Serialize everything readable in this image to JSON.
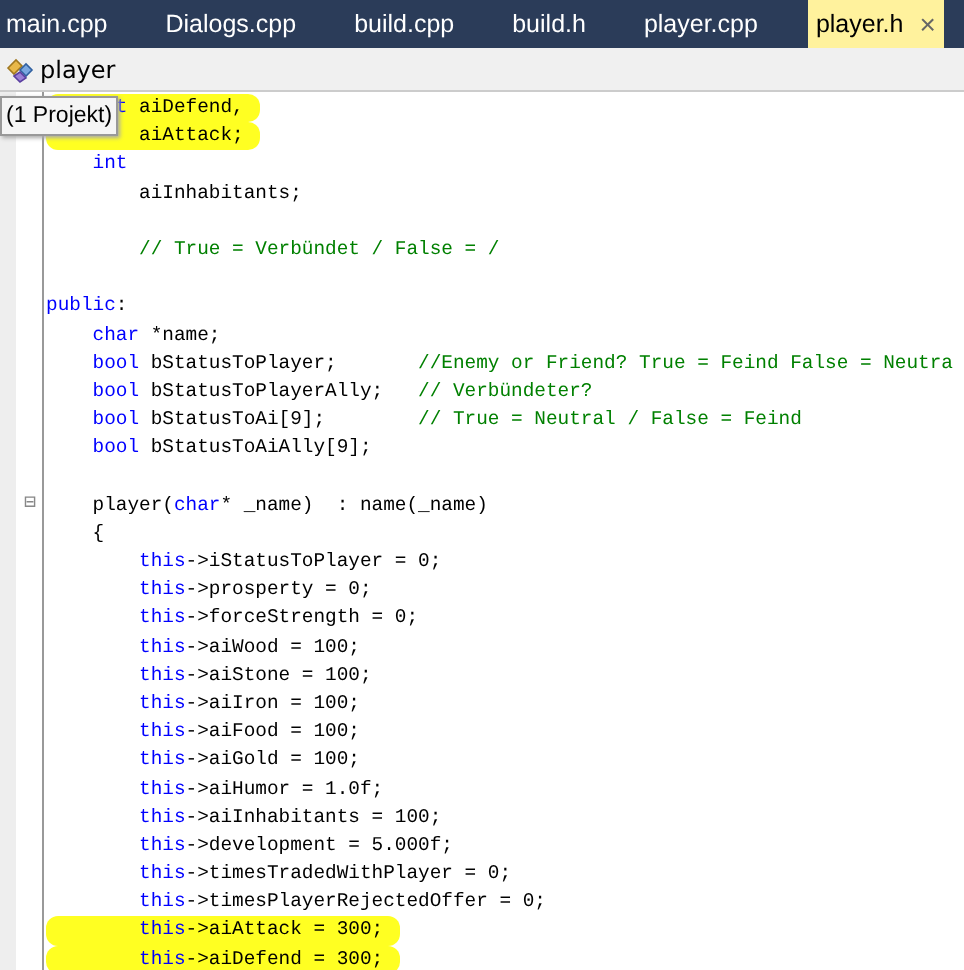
{
  "tabs": [
    {
      "label": "main.cpp",
      "selected": false
    },
    {
      "label": "Dialogs.cpp",
      "selected": false
    },
    {
      "label": "build.cpp",
      "selected": false
    },
    {
      "label": "build.h",
      "selected": false
    },
    {
      "label": "player.cpp",
      "selected": false
    },
    {
      "label": "player.h",
      "selected": true,
      "close": "×"
    }
  ],
  "navigation_bar": {
    "label": "player"
  },
  "tooltip": "(1 Projekt)",
  "code_lines": [
    {
      "highlighted": true,
      "tokens": [
        {
          "kind": "keyword",
          "text": "      t"
        },
        {
          "kind": "plain",
          "text": " aiDefend,"
        }
      ]
    },
    {
      "highlighted": true,
      "tokens": [
        {
          "kind": "plain",
          "text": "        aiAttack;"
        }
      ]
    },
    {
      "highlighted": false,
      "tokens": [
        {
          "kind": "keyword",
          "text": "    int"
        }
      ]
    },
    {
      "highlighted": false,
      "tokens": [
        {
          "kind": "plain",
          "text": "        aiInhabitants;"
        }
      ]
    },
    {
      "blank": true
    },
    {
      "highlighted": false,
      "tokens": [
        {
          "kind": "comment",
          "text": "        // True = Verbündet / False = /"
        }
      ]
    },
    {
      "blank": true
    },
    {
      "highlighted": false,
      "tokens": [
        {
          "kind": "keyword",
          "text": "public"
        },
        {
          "kind": "plain",
          "text": ":"
        }
      ]
    },
    {
      "highlighted": false,
      "tokens": [
        {
          "kind": "keyword",
          "text": "    char"
        },
        {
          "kind": "plain",
          "text": " *name;"
        }
      ]
    },
    {
      "highlighted": false,
      "tokens": [
        {
          "kind": "keyword",
          "text": "    bool"
        },
        {
          "kind": "plain",
          "text": " bStatusToPlayer;       "
        },
        {
          "kind": "comment",
          "text": "//Enemy or Friend? True = Feind False = Neutra"
        }
      ]
    },
    {
      "highlighted": false,
      "tokens": [
        {
          "kind": "keyword",
          "text": "    bool"
        },
        {
          "kind": "plain",
          "text": " bStatusToPlayerAlly;   "
        },
        {
          "kind": "comment",
          "text": "// Verbündeter?"
        }
      ]
    },
    {
      "highlighted": false,
      "tokens": [
        {
          "kind": "keyword",
          "text": "    bool"
        },
        {
          "kind": "plain",
          "text": " bStatusToAi[9];        "
        },
        {
          "kind": "comment",
          "text": "// True = Neutral / False = Feind"
        }
      ]
    },
    {
      "highlighted": false,
      "tokens": [
        {
          "kind": "keyword",
          "text": "    bool"
        },
        {
          "kind": "plain",
          "text": " bStatusToAiAlly[9];"
        }
      ]
    },
    {
      "blank": true
    },
    {
      "highlighted": false,
      "fold": "⊟",
      "tokens": [
        {
          "kind": "plain",
          "text": "    player("
        },
        {
          "kind": "keyword",
          "text": "char"
        },
        {
          "kind": "plain",
          "text": "* _name)  : name(_name)"
        }
      ]
    },
    {
      "highlighted": false,
      "tokens": [
        {
          "kind": "plain",
          "text": "    {"
        }
      ]
    },
    {
      "highlighted": false,
      "tokens": [
        {
          "kind": "keyword",
          "text": "        this"
        },
        {
          "kind": "plain",
          "text": "->iStatusToPlayer = 0;"
        }
      ]
    },
    {
      "highlighted": false,
      "tokens": [
        {
          "kind": "keyword",
          "text": "        this"
        },
        {
          "kind": "plain",
          "text": "->prosperty = 0;"
        }
      ]
    },
    {
      "highlighted": false,
      "tokens": [
        {
          "kind": "keyword",
          "text": "        this"
        },
        {
          "kind": "plain",
          "text": "->forceStrength = 0;"
        }
      ]
    },
    {
      "highlighted": false,
      "tokens": [
        {
          "kind": "keyword",
          "text": "        this"
        },
        {
          "kind": "plain",
          "text": "->aiWood = 100;"
        }
      ]
    },
    {
      "highlighted": false,
      "tokens": [
        {
          "kind": "keyword",
          "text": "        this"
        },
        {
          "kind": "plain",
          "text": "->aiStone = 100;"
        }
      ]
    },
    {
      "highlighted": false,
      "tokens": [
        {
          "kind": "keyword",
          "text": "        this"
        },
        {
          "kind": "plain",
          "text": "->aiIron = 100;"
        }
      ]
    },
    {
      "highlighted": false,
      "tokens": [
        {
          "kind": "keyword",
          "text": "        this"
        },
        {
          "kind": "plain",
          "text": "->aiFood = 100;"
        }
      ]
    },
    {
      "highlighted": false,
      "tokens": [
        {
          "kind": "keyword",
          "text": "        this"
        },
        {
          "kind": "plain",
          "text": "->aiGold = 100;"
        }
      ]
    },
    {
      "highlighted": false,
      "tokens": [
        {
          "kind": "keyword",
          "text": "        this"
        },
        {
          "kind": "plain",
          "text": "->aiHumor = 1.0f;"
        }
      ]
    },
    {
      "highlighted": false,
      "tokens": [
        {
          "kind": "keyword",
          "text": "        this"
        },
        {
          "kind": "plain",
          "text": "->aiInhabitants = 100;"
        }
      ]
    },
    {
      "highlighted": false,
      "tokens": [
        {
          "kind": "keyword",
          "text": "        this"
        },
        {
          "kind": "plain",
          "text": "->development = 5.000f;"
        }
      ]
    },
    {
      "highlighted": false,
      "tokens": [
        {
          "kind": "keyword",
          "text": "        this"
        },
        {
          "kind": "plain",
          "text": "->timesTradedWithPlayer = 0;"
        }
      ]
    },
    {
      "highlighted": false,
      "tokens": [
        {
          "kind": "keyword",
          "text": "        this"
        },
        {
          "kind": "plain",
          "text": "->timesPlayerRejectedOffer = 0;"
        }
      ]
    },
    {
      "highlighted": true,
      "tokens": [
        {
          "kind": "keyword",
          "text": "        this"
        },
        {
          "kind": "plain",
          "text": "->aiAttack = 300;"
        }
      ]
    },
    {
      "highlighted": true,
      "tokens": [
        {
          "kind": "keyword",
          "text": "        this"
        },
        {
          "kind": "plain",
          "text": "->aiDefend = 300;"
        }
      ]
    }
  ]
}
